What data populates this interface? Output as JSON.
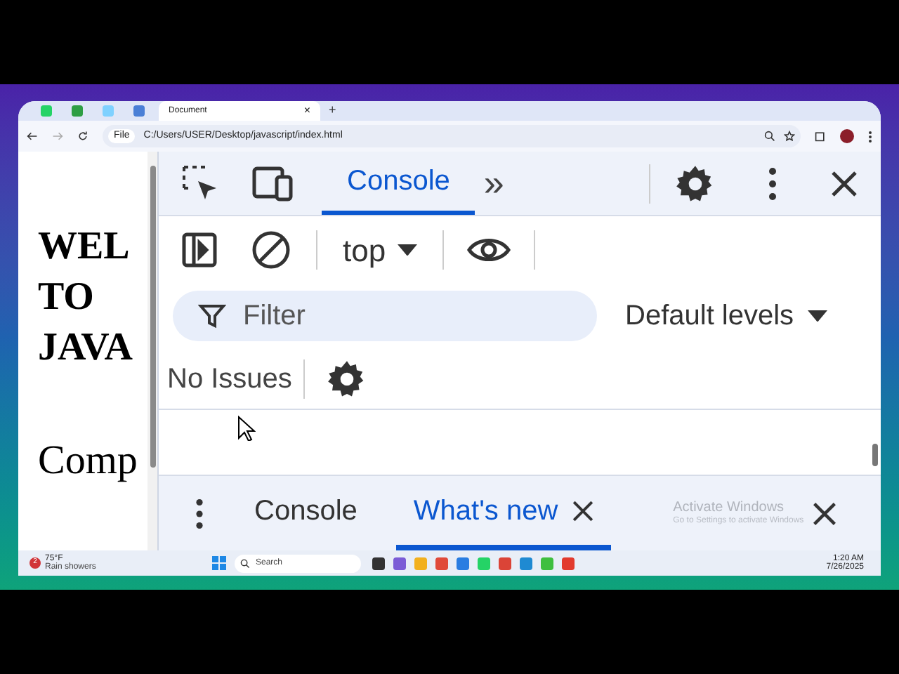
{
  "browser": {
    "tabs": [
      {
        "kind": "pinned",
        "color": "#25d366"
      },
      {
        "kind": "pinned",
        "color": "#2e9e44"
      },
      {
        "kind": "pinned",
        "color": "#7fd1ff"
      },
      {
        "kind": "pinned",
        "color": "#4a7fd6"
      },
      {
        "kind": "page",
        "title": "Document",
        "close": "×",
        "selected": true
      }
    ],
    "new_tab": "+",
    "address": {
      "badge": "File",
      "url": "C:/Users/USER/Desktop/javascript/index.html"
    }
  },
  "page": {
    "heading_lines": [
      "WEL",
      "TO",
      "JAVA"
    ],
    "paragraph": "Comp"
  },
  "devtools": {
    "tabs": [
      {
        "label": "Console",
        "selected": true
      }
    ],
    "more": "»",
    "context": "top",
    "filter": {
      "placeholder": "Filter"
    },
    "levels": "Default levels",
    "issues": "No Issues",
    "drawer": {
      "tabs": [
        {
          "label": "Console",
          "selected": false,
          "closable": false
        },
        {
          "label": "What's new",
          "selected": true,
          "closable": true
        }
      ]
    }
  },
  "activation": {
    "title": "Activate Windows",
    "hint": "Go to Settings to activate Windows"
  },
  "taskbar": {
    "weather": {
      "badge": "2",
      "temp": "75°F",
      "condition": "Rain showers"
    },
    "search": "Search",
    "apps": [
      {
        "color": "#333333"
      },
      {
        "color": "#7b5cd6"
      },
      {
        "color": "#f2b01e"
      },
      {
        "color": "#e04a3a"
      },
      {
        "color": "#2a7de1"
      },
      {
        "color": "#25d366"
      },
      {
        "color": "#db4437"
      },
      {
        "color": "#1f8ad2"
      },
      {
        "color": "#3fbf3f"
      },
      {
        "color": "#e23b2e"
      }
    ],
    "time": "1:20 AM",
    "date": "7/26/2025"
  }
}
